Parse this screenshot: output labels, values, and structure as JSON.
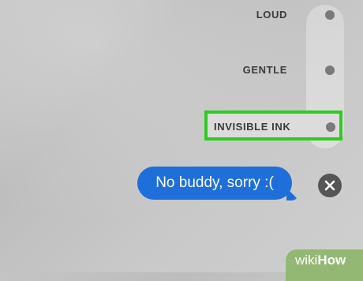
{
  "effects": {
    "loud": "LOUD",
    "gentle": "GENTLE",
    "invisible_ink": "INVISIBLE INK"
  },
  "message": {
    "text": "No buddy, sorry :("
  },
  "watermark": {
    "prefix": "wiki",
    "suffix": "How"
  },
  "colors": {
    "highlight": "#2ecc1f",
    "bubble": "#1e6fd9",
    "watermark": "#93b873"
  },
  "icons": {
    "cancel": "close-icon"
  }
}
